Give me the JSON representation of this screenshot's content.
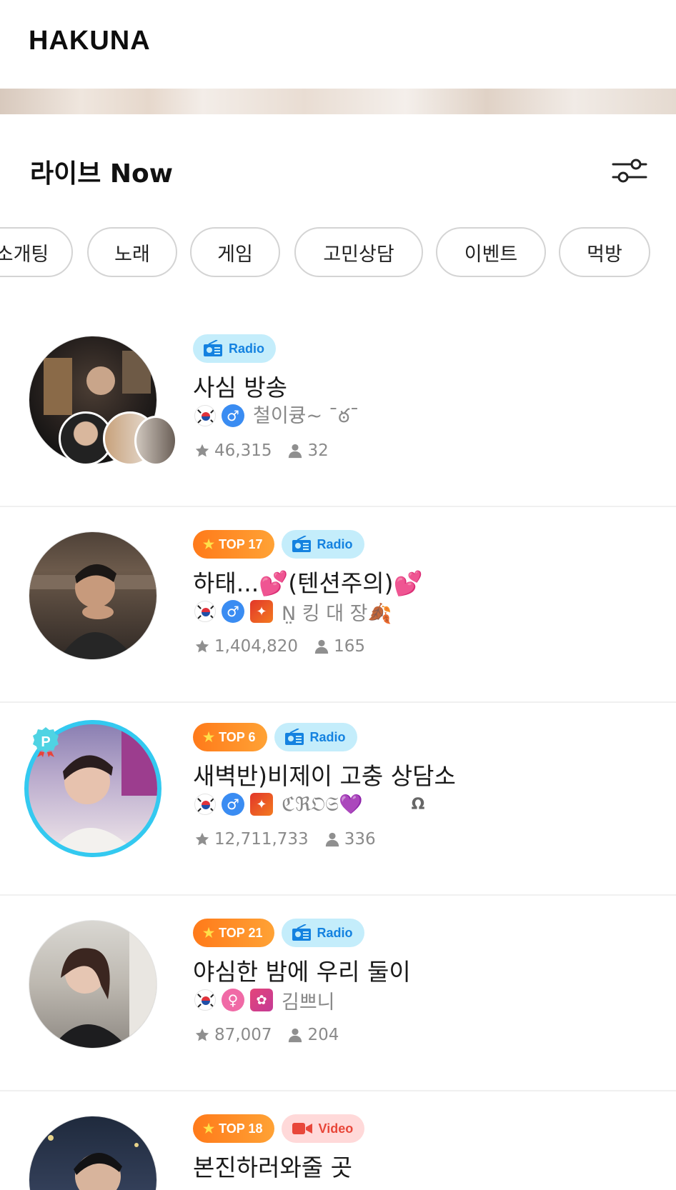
{
  "app": {
    "logo": "HAKUNA"
  },
  "section": {
    "title": "라이브 Now"
  },
  "categories": [
    "소개팅",
    "노래",
    "게임",
    "고민상담",
    "이벤트",
    "먹방"
  ],
  "colors": {
    "accent_ring": "#33c9f0",
    "top_badge": "#ff8a22",
    "radio_badge": "#c4edfb",
    "video_badge": "#ffd9d9"
  },
  "streams": [
    {
      "top": null,
      "type": "Radio",
      "title": "사심 방송",
      "host_gender": "male",
      "host_name": "철이큥~ ¯ఠ¯",
      "host_extra": "",
      "stars": "46,315",
      "viewers": "32"
    },
    {
      "top": "TOP 17",
      "type": "Radio",
      "title": "하태...💕(텐션주의)💕",
      "host_gender": "male",
      "host_name": "N̤ 킹 대 장🍂",
      "host_extra": "",
      "stars": "1,404,820",
      "viewers": "165"
    },
    {
      "top": "TOP 6",
      "type": "Radio",
      "title": "새벽반)비제이 고충 상담소",
      "host_gender": "male",
      "host_name": "ℭℜ𝔒𝔖💜",
      "host_extra": "Ω",
      "stars": "12,711,733",
      "viewers": "336"
    },
    {
      "top": "TOP 21",
      "type": "Radio",
      "title": "야심한 밤에 우리 둘이",
      "host_gender": "female",
      "host_name": "김쁘니",
      "host_extra": "",
      "stars": "87,007",
      "viewers": "204"
    },
    {
      "top": "TOP 18",
      "type": "Video",
      "title": "본진하러와줄 곳",
      "host_gender": "",
      "host_name": "",
      "host_extra": "",
      "stars": "",
      "viewers": ""
    }
  ]
}
